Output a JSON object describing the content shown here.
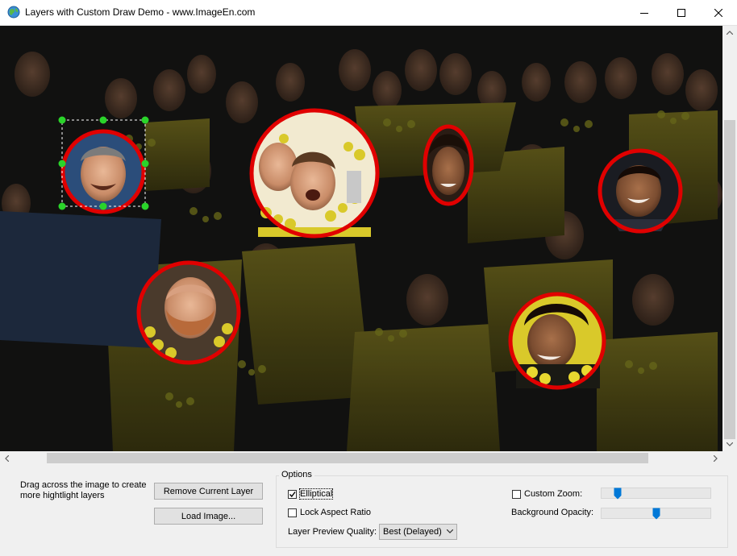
{
  "window": {
    "title": "Layers with Custom Draw Demo  - www.ImageEn.com",
    "icon": "globe-app-icon",
    "controls": [
      "minimize-icon",
      "maximize-icon",
      "close-icon"
    ]
  },
  "viewer": {
    "layers": [
      {
        "name": "layer-1",
        "selected": true
      },
      {
        "name": "layer-2",
        "selected": false
      },
      {
        "name": "layer-3",
        "selected": false
      },
      {
        "name": "layer-4",
        "selected": false
      },
      {
        "name": "layer-5",
        "selected": false
      },
      {
        "name": "layer-6",
        "selected": false
      }
    ],
    "highlight_color": "#e00000",
    "handle_color": "#2ad42a",
    "background_color": "#0e0e0c",
    "jersey_color": "#d9c92a"
  },
  "controls": {
    "hint": "Drag across the image to create more hightlight layers",
    "remove_button": "Remove Current Layer",
    "load_button": "Load Image...",
    "options_title": "Options",
    "elliptical": {
      "label": "Elliptical",
      "checked": true
    },
    "lock_aspect": {
      "label": "Lock Aspect Ratio",
      "checked": false
    },
    "quality_label": "Layer Preview Quality:",
    "quality_value": "Best (Delayed)",
    "custom_zoom": {
      "label": "Custom Zoom:",
      "checked": false,
      "slider_value": 0.12
    },
    "background_opacity": {
      "label": "Background Opacity:",
      "slider_value": 0.5
    }
  }
}
